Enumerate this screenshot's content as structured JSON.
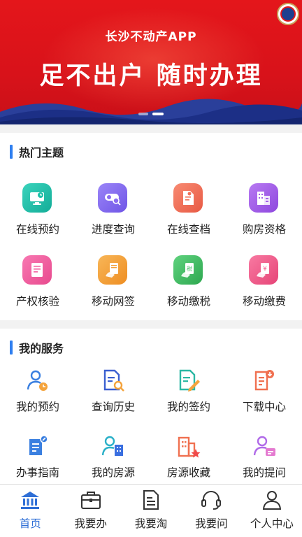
{
  "banner": {
    "app_name": "长沙不动产APP",
    "slogan": "足不出户  随时办理",
    "slide_count": 2,
    "active_slide": 2
  },
  "hot": {
    "title": "热门主题",
    "items": [
      {
        "label": "在线预约",
        "icon": "monitor-clock-icon",
        "color": "#1ec0a8"
      },
      {
        "label": "进度查询",
        "icon": "toggle-search-icon",
        "color": "#8a6cf0"
      },
      {
        "label": "在线查档",
        "icon": "document-search-icon",
        "color": "#f07058"
      },
      {
        "label": "购房资格",
        "icon": "building-icon",
        "color": "#a560e8"
      },
      {
        "label": "产权核验",
        "icon": "certificate-icon",
        "color": "#f35fa0"
      },
      {
        "label": "移动网签",
        "icon": "hand-sign-icon",
        "color": "#f5a23c"
      },
      {
        "label": "移动缴税",
        "icon": "hand-tax-icon",
        "color": "#3fbd62"
      },
      {
        "label": "移动缴费",
        "icon": "hand-pay-icon",
        "color": "#f25a8a"
      }
    ]
  },
  "services": {
    "title": "我的服务",
    "items": [
      {
        "label": "我的预约",
        "icon": "user-clock-icon"
      },
      {
        "label": "查询历史",
        "icon": "document-search-icon"
      },
      {
        "label": "我的签约",
        "icon": "document-edit-icon"
      },
      {
        "label": "下载中心",
        "icon": "download-document-icon"
      },
      {
        "label": "办事指南",
        "icon": "guide-icon"
      },
      {
        "label": "我的房源",
        "icon": "user-building-icon"
      },
      {
        "label": "房源收藏",
        "icon": "building-star-icon"
      },
      {
        "label": "我的提问",
        "icon": "user-question-icon"
      }
    ]
  },
  "tabbar": {
    "tabs": [
      {
        "label": "首页",
        "icon": "bank-icon",
        "active": true
      },
      {
        "label": "我要办",
        "icon": "briefcase-icon",
        "active": false
      },
      {
        "label": "我要淘",
        "icon": "document-icon",
        "active": false
      },
      {
        "label": "我要问",
        "icon": "headset-icon",
        "active": false
      },
      {
        "label": "个人中心",
        "icon": "user-icon",
        "active": false
      }
    ]
  },
  "colors": {
    "brand_red": "#e4161b",
    "accent_blue": "#2f7ff0",
    "active_tab": "#2f6fd6"
  }
}
